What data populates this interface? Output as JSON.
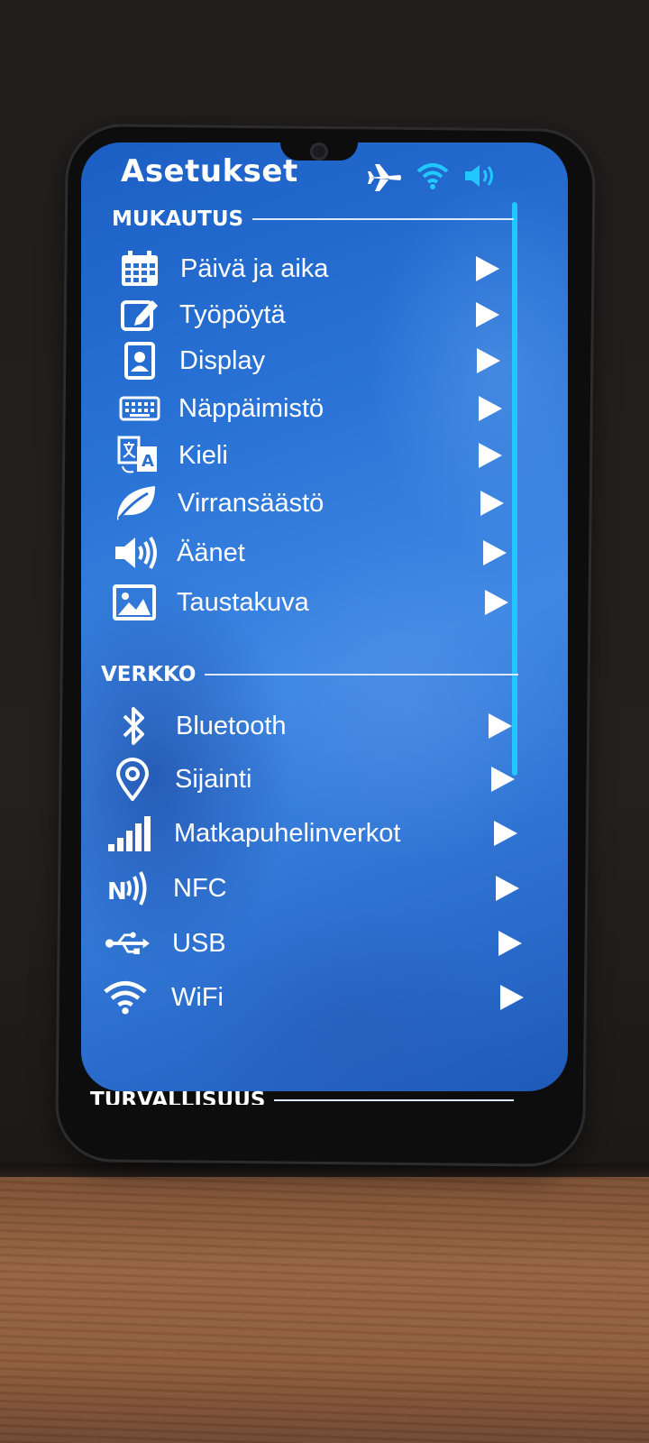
{
  "screen": {
    "title": "Asetukset",
    "status_icons": [
      "airplane-icon",
      "wifi-icon",
      "volume-icon"
    ],
    "accent_color": "#21c8ff"
  },
  "sections": {
    "mukautus": {
      "label": "MUKAUTUS",
      "items": [
        {
          "label": "Päivä ja aika",
          "icon": "calendar-icon"
        },
        {
          "label": "Työpöytä",
          "icon": "edit-icon"
        },
        {
          "label": "Display",
          "icon": "portrait-display-icon"
        },
        {
          "label": "Näppäimistö",
          "icon": "keyboard-icon"
        },
        {
          "label": "Kieli",
          "icon": "language-icon"
        },
        {
          "label": "Virransäästö",
          "icon": "leaf-icon"
        },
        {
          "label": "Äänet",
          "icon": "speaker-icon"
        },
        {
          "label": "Taustakuva",
          "icon": "image-icon"
        }
      ]
    },
    "verkko": {
      "label": "VERKKO",
      "items": [
        {
          "label": "Bluetooth",
          "icon": "bluetooth-icon"
        },
        {
          "label": "Sijainti",
          "icon": "location-pin-icon"
        },
        {
          "label": "Matkapuhelinverkot",
          "icon": "signal-bars-icon"
        },
        {
          "label": "NFC",
          "icon": "nfc-icon"
        },
        {
          "label": "USB",
          "icon": "usb-icon"
        },
        {
          "label": "WiFi",
          "icon": "wifi-icon"
        }
      ]
    },
    "turvallisuus": {
      "label": "TURVALLISUUS"
    }
  }
}
